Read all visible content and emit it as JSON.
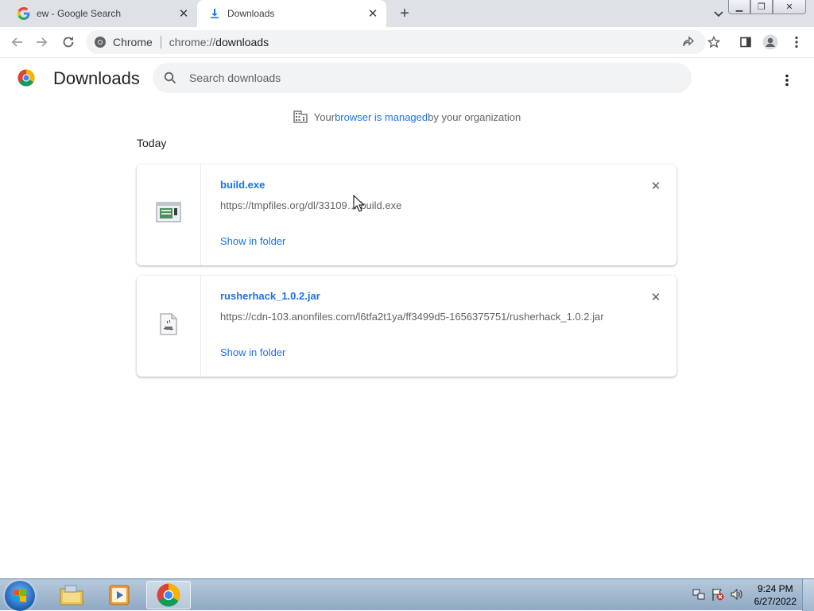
{
  "tabs": [
    {
      "title": "ew - Google Search",
      "favicon": "google-g-icon"
    },
    {
      "title": "Downloads",
      "favicon": "download-icon"
    }
  ],
  "toolbar": {
    "site_chip": "Chrome",
    "url_scheme": "chrome://",
    "url_path": "downloads"
  },
  "page": {
    "title": "Downloads",
    "search_placeholder": "Search downloads"
  },
  "managed": {
    "prefix": "Your ",
    "link": "browser is managed",
    "suffix": " by your organization"
  },
  "section_heading": "Today",
  "downloads": [
    {
      "filename": "build.exe",
      "url": "https://tmpfiles.org/dl/33109…/build.exe",
      "action": "Show in folder",
      "icon": "exe-file-icon"
    },
    {
      "filename": "rusherhack_1.0.2.jar",
      "url": "https://cdn-103.anonfiles.com/l6tfa2t1ya/ff3499d5-1656375751/rusherhack_1.0.2.jar",
      "action": "Show in folder",
      "icon": "jar-file-icon"
    }
  ],
  "taskbar": {
    "time": "9:24 PM",
    "date": "6/27/2022"
  },
  "colors": {
    "accent": "#1a73e8",
    "tabstrip": "#dee1e6",
    "taskbar": "#9fb6cf"
  }
}
